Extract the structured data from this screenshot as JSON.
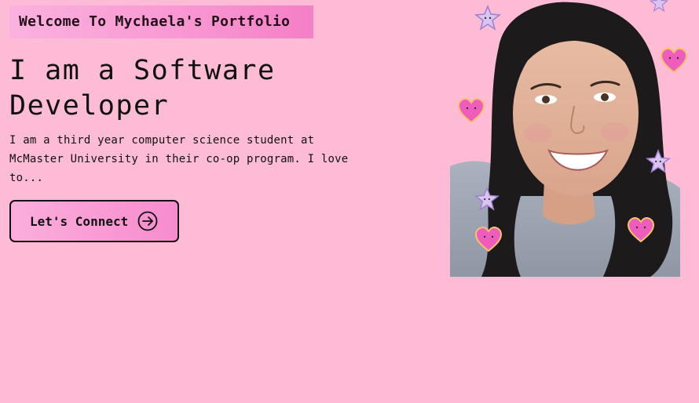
{
  "header": {
    "badge": "Welcome To Mychaela's Portfolio"
  },
  "hero": {
    "headline": "I am a Software Developer",
    "intro": "I am a third year computer science student at McMaster University in their co-op program. I love to...",
    "cta_label": "Let's Connect",
    "cta_icon": "arrow-right-circle-icon"
  },
  "portrait": {
    "stickers": [
      "heart-icon",
      "star-icon"
    ]
  },
  "colors": {
    "background": "#fdbbd6",
    "accent": "#f47fc6",
    "text": "#111111"
  }
}
